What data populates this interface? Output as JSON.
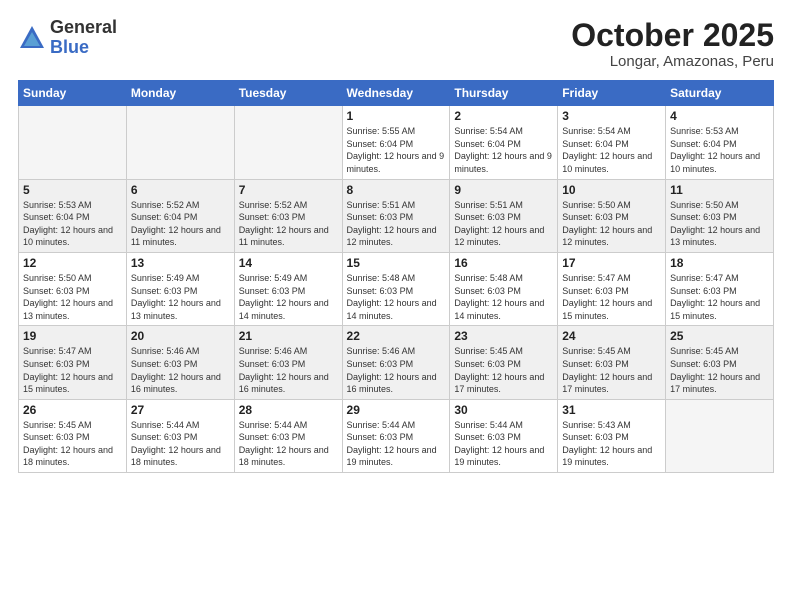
{
  "logo": {
    "general": "General",
    "blue": "Blue"
  },
  "title": "October 2025",
  "subtitle": "Longar, Amazonas, Peru",
  "days_of_week": [
    "Sunday",
    "Monday",
    "Tuesday",
    "Wednesday",
    "Thursday",
    "Friday",
    "Saturday"
  ],
  "weeks": [
    [
      {
        "num": "",
        "info": "",
        "empty": true
      },
      {
        "num": "",
        "info": "",
        "empty": true
      },
      {
        "num": "",
        "info": "",
        "empty": true
      },
      {
        "num": "1",
        "info": "Sunrise: 5:55 AM\nSunset: 6:04 PM\nDaylight: 12 hours and 9 minutes.",
        "empty": false
      },
      {
        "num": "2",
        "info": "Sunrise: 5:54 AM\nSunset: 6:04 PM\nDaylight: 12 hours and 9 minutes.",
        "empty": false
      },
      {
        "num": "3",
        "info": "Sunrise: 5:54 AM\nSunset: 6:04 PM\nDaylight: 12 hours and 10 minutes.",
        "empty": false
      },
      {
        "num": "4",
        "info": "Sunrise: 5:53 AM\nSunset: 6:04 PM\nDaylight: 12 hours and 10 minutes.",
        "empty": false
      }
    ],
    [
      {
        "num": "5",
        "info": "Sunrise: 5:53 AM\nSunset: 6:04 PM\nDaylight: 12 hours and 10 minutes.",
        "empty": false
      },
      {
        "num": "6",
        "info": "Sunrise: 5:52 AM\nSunset: 6:04 PM\nDaylight: 12 hours and 11 minutes.",
        "empty": false
      },
      {
        "num": "7",
        "info": "Sunrise: 5:52 AM\nSunset: 6:03 PM\nDaylight: 12 hours and 11 minutes.",
        "empty": false
      },
      {
        "num": "8",
        "info": "Sunrise: 5:51 AM\nSunset: 6:03 PM\nDaylight: 12 hours and 12 minutes.",
        "empty": false
      },
      {
        "num": "9",
        "info": "Sunrise: 5:51 AM\nSunset: 6:03 PM\nDaylight: 12 hours and 12 minutes.",
        "empty": false
      },
      {
        "num": "10",
        "info": "Sunrise: 5:50 AM\nSunset: 6:03 PM\nDaylight: 12 hours and 12 minutes.",
        "empty": false
      },
      {
        "num": "11",
        "info": "Sunrise: 5:50 AM\nSunset: 6:03 PM\nDaylight: 12 hours and 13 minutes.",
        "empty": false
      }
    ],
    [
      {
        "num": "12",
        "info": "Sunrise: 5:50 AM\nSunset: 6:03 PM\nDaylight: 12 hours and 13 minutes.",
        "empty": false
      },
      {
        "num": "13",
        "info": "Sunrise: 5:49 AM\nSunset: 6:03 PM\nDaylight: 12 hours and 13 minutes.",
        "empty": false
      },
      {
        "num": "14",
        "info": "Sunrise: 5:49 AM\nSunset: 6:03 PM\nDaylight: 12 hours and 14 minutes.",
        "empty": false
      },
      {
        "num": "15",
        "info": "Sunrise: 5:48 AM\nSunset: 6:03 PM\nDaylight: 12 hours and 14 minutes.",
        "empty": false
      },
      {
        "num": "16",
        "info": "Sunrise: 5:48 AM\nSunset: 6:03 PM\nDaylight: 12 hours and 14 minutes.",
        "empty": false
      },
      {
        "num": "17",
        "info": "Sunrise: 5:47 AM\nSunset: 6:03 PM\nDaylight: 12 hours and 15 minutes.",
        "empty": false
      },
      {
        "num": "18",
        "info": "Sunrise: 5:47 AM\nSunset: 6:03 PM\nDaylight: 12 hours and 15 minutes.",
        "empty": false
      }
    ],
    [
      {
        "num": "19",
        "info": "Sunrise: 5:47 AM\nSunset: 6:03 PM\nDaylight: 12 hours and 15 minutes.",
        "empty": false
      },
      {
        "num": "20",
        "info": "Sunrise: 5:46 AM\nSunset: 6:03 PM\nDaylight: 12 hours and 16 minutes.",
        "empty": false
      },
      {
        "num": "21",
        "info": "Sunrise: 5:46 AM\nSunset: 6:03 PM\nDaylight: 12 hours and 16 minutes.",
        "empty": false
      },
      {
        "num": "22",
        "info": "Sunrise: 5:46 AM\nSunset: 6:03 PM\nDaylight: 12 hours and 16 minutes.",
        "empty": false
      },
      {
        "num": "23",
        "info": "Sunrise: 5:45 AM\nSunset: 6:03 PM\nDaylight: 12 hours and 17 minutes.",
        "empty": false
      },
      {
        "num": "24",
        "info": "Sunrise: 5:45 AM\nSunset: 6:03 PM\nDaylight: 12 hours and 17 minutes.",
        "empty": false
      },
      {
        "num": "25",
        "info": "Sunrise: 5:45 AM\nSunset: 6:03 PM\nDaylight: 12 hours and 17 minutes.",
        "empty": false
      }
    ],
    [
      {
        "num": "26",
        "info": "Sunrise: 5:45 AM\nSunset: 6:03 PM\nDaylight: 12 hours and 18 minutes.",
        "empty": false
      },
      {
        "num": "27",
        "info": "Sunrise: 5:44 AM\nSunset: 6:03 PM\nDaylight: 12 hours and 18 minutes.",
        "empty": false
      },
      {
        "num": "28",
        "info": "Sunrise: 5:44 AM\nSunset: 6:03 PM\nDaylight: 12 hours and 18 minutes.",
        "empty": false
      },
      {
        "num": "29",
        "info": "Sunrise: 5:44 AM\nSunset: 6:03 PM\nDaylight: 12 hours and 19 minutes.",
        "empty": false
      },
      {
        "num": "30",
        "info": "Sunrise: 5:44 AM\nSunset: 6:03 PM\nDaylight: 12 hours and 19 minutes.",
        "empty": false
      },
      {
        "num": "31",
        "info": "Sunrise: 5:43 AM\nSunset: 6:03 PM\nDaylight: 12 hours and 19 minutes.",
        "empty": false
      },
      {
        "num": "",
        "info": "",
        "empty": true
      }
    ]
  ]
}
